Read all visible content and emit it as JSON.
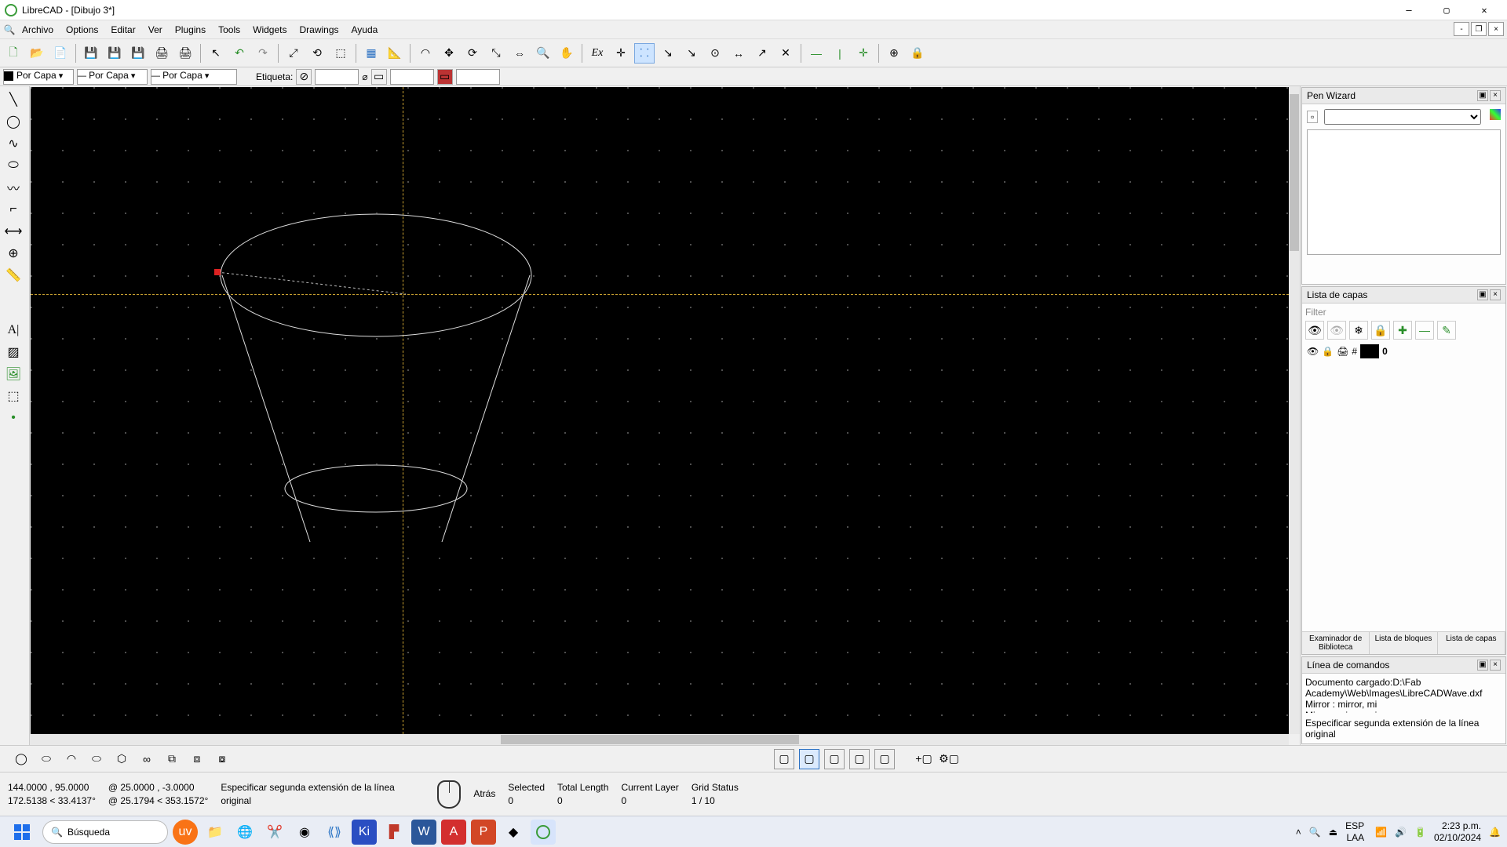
{
  "title": "LibreCAD - [Dibujo 3*]",
  "menu": {
    "search": "🔍",
    "archivo": "Archivo",
    "options": "Options",
    "editar": "Editar",
    "ver": "Ver",
    "plugins": "Plugins",
    "tools": "Tools",
    "widgets": "Widgets",
    "drawings": "Drawings",
    "ayuda": "Ayuda"
  },
  "propbar": {
    "color": "Por Capa",
    "line": "Por Capa",
    "width": "Por Capa",
    "etiqueta_label": "Etiqueta:",
    "diam": "⌀"
  },
  "pen_wizard": {
    "title": "Pen Wizard"
  },
  "layers": {
    "title": "Lista de capas",
    "filter": "Filter",
    "layer0": "0",
    "tab1": "Examinador de Biblioteca",
    "tab2": "Lista de bloques",
    "tab3": "Lista de capas"
  },
  "cmdline": {
    "title": "Línea de comandos",
    "log1": "Documento cargado:D:\\Fab Academy\\Web\\Images\\LibreCADWave.dxf",
    "log2": "Mirror : mirror, mi",
    "log3": "Mirror : mirror, mi",
    "prompt": "Especificar segunda extensión de la línea original"
  },
  "status": {
    "abs1": "144.0000 , 95.0000",
    "abs2": "172.5138 < 33.4137°",
    "rel1": "@  25.0000 , -3.0000",
    "rel2": "@  25.1794 < 353.1572°",
    "prompt": "Especificar segunda extensión de la línea original",
    "atras": "Atrás",
    "selected_h": "Selected",
    "selected_v": "0",
    "tlen_h": "Total Length",
    "tlen_v": "0",
    "curlay_h": "Current Layer",
    "curlay_v": "0",
    "grid_h": "Grid Status",
    "grid_v": "1 / 10"
  },
  "taskbar": {
    "search": "Búsqueda",
    "lang1": "ESP",
    "lang2": "LAA",
    "time": "2:23 p.m.",
    "date": "02/10/2024"
  }
}
